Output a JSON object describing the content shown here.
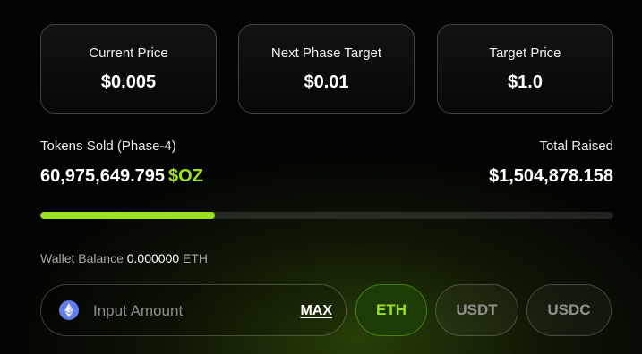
{
  "cards": [
    {
      "label": "Current Price",
      "value": "$0.005"
    },
    {
      "label": "Next Phase Target",
      "value": "$0.01"
    },
    {
      "label": "Target Price",
      "value": "$1.0"
    }
  ],
  "tokens_sold": {
    "label": "Tokens Sold (Phase-4)",
    "amount": "60,975,649.795",
    "symbol": "$OZ"
  },
  "total_raised": {
    "label": "Total Raised",
    "amount": "$1,504,878.158"
  },
  "progress": {
    "fraction": 0.305
  },
  "wallet": {
    "label": "Wallet Balance",
    "value": "0.000000",
    "unit": "ETH"
  },
  "amount_input": {
    "placeholder": "Input Amount",
    "value": "",
    "max_label": "MAX",
    "icon": "ethereum-icon"
  },
  "currencies": [
    {
      "label": "ETH",
      "selected": true
    },
    {
      "label": "USDT",
      "selected": false
    },
    {
      "label": "USDC",
      "selected": false
    }
  ],
  "colors": {
    "accent": "#9be21a",
    "background": "#040503",
    "selected_button_bg": "#1d3c05"
  }
}
